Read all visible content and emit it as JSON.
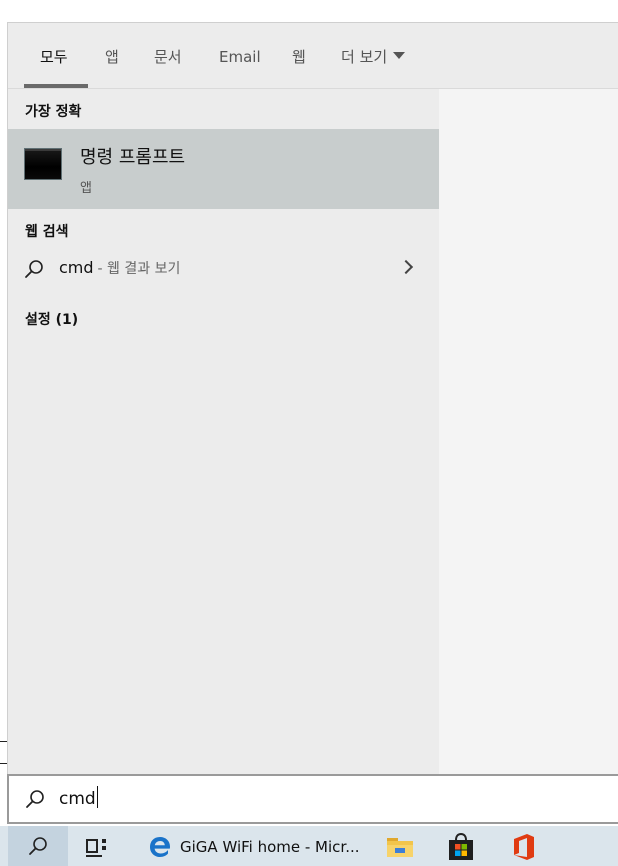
{
  "tabs": {
    "items": [
      {
        "label": "모두",
        "active": true
      },
      {
        "label": "앱"
      },
      {
        "label": "문서"
      },
      {
        "label": "Email"
      },
      {
        "label": "웹"
      },
      {
        "label": "더 보기"
      }
    ]
  },
  "best_match": {
    "heading": "가장 정확",
    "title": "명령 프롬프트",
    "subtitle": "앱",
    "icon": "command-prompt-icon"
  },
  "web_search": {
    "heading": "웹 검색",
    "query": "cmd",
    "suffix": "- 웹 결과 보기",
    "icon": "search-icon"
  },
  "settings": {
    "heading": "설정 (1)"
  },
  "search_box": {
    "value": "cmd",
    "icon": "search-icon"
  },
  "taskbar": {
    "search_icon": "search-icon",
    "task_view_icon": "task-view-icon",
    "edge_label": "GiGA WiFi home - Micr...",
    "apps": [
      "edge-icon",
      "file-explorer-icon",
      "microsoft-store-icon",
      "office-icon"
    ]
  },
  "colors": {
    "tab_bar": "#ececec",
    "left_pane": "#ececec",
    "best_match_highlight": "#c8cdcd",
    "taskbar": "#dbe5ec"
  }
}
